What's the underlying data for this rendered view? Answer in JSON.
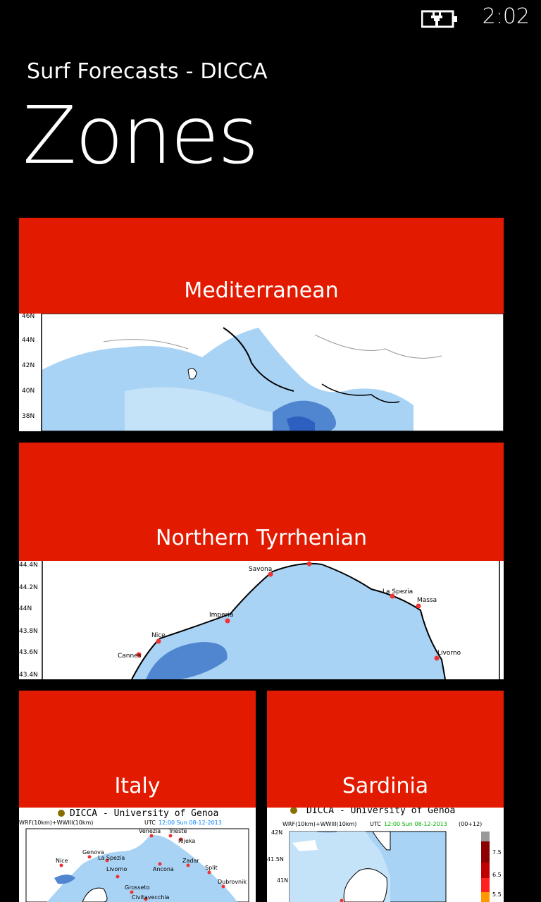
{
  "status": {
    "time": "2:02",
    "battery_icon": "battery-charging-icon"
  },
  "app": {
    "title": "Surf Forecasts - DICCA"
  },
  "page": {
    "title": "Zones"
  },
  "colors": {
    "accent": "#e21a00",
    "sea": "#a9d3f5",
    "sea_dark": "#4f86cf",
    "land": "#ffffff"
  },
  "tiles": [
    {
      "label": "Mediterranean",
      "lat_ticks": [
        "46N",
        "44N",
        "42N",
        "40N",
        "38N"
      ]
    },
    {
      "label": "Northern Tyrrhenian",
      "lat_ticks": [
        "44.4N",
        "44.2N",
        "44N",
        "43.8N",
        "43.6N",
        "43.4N"
      ],
      "cities": [
        "Savona",
        "La Spezia",
        "Massa",
        "Imperia",
        "Nice",
        "Cannes",
        "Livorno"
      ]
    },
    {
      "label": "Italy",
      "header": "DICCA - University of Genoa",
      "model": "WRF(10km)+WWIII(10km)",
      "utc_prefix": "UTC",
      "utc": "12:00 Sun 08-12-2013",
      "cities": [
        "Venezia",
        "Trieste",
        "Rijeka",
        "Genova",
        "La Spezia",
        "Nice",
        "Livorno",
        "Ancona",
        "Zadar",
        "Split",
        "Dubrovnik",
        "Grosseto",
        "Civitavecchia"
      ]
    },
    {
      "label": "Sardinia",
      "header": "DICCA - University of Genoa",
      "model": "WRF(10km)+WWIII(10km)",
      "utc_prefix": "UTC",
      "utc": "12:00 Sun 08-12-2013",
      "step": "(00+12)",
      "lat_ticks": [
        "42N",
        "41.5N",
        "41N"
      ],
      "scale_values": [
        "7.5",
        "6.5",
        "5.5"
      ]
    }
  ]
}
